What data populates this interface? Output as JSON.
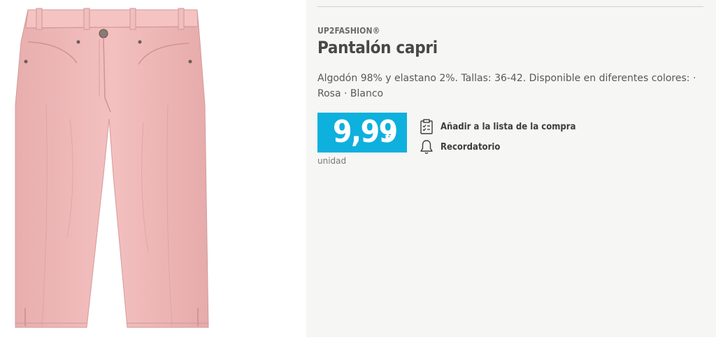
{
  "product": {
    "brand": "UP2FASHION®",
    "title": "Pantalón capri",
    "description": "Algodón 98% y elastano 2%. Tallas: 36-42. Disponible en diferentes colores: · Rosa · Blanco",
    "image_alt": "Pantalón capri rosa",
    "colors": {
      "pants": "#f0b9b8",
      "pants_shadow": "#dfa2a1",
      "price_bg": "#0eb0dd"
    }
  },
  "price": {
    "amount": "9,99",
    "currency": "€",
    "unit": "unidad"
  },
  "actions": {
    "add_to_list": {
      "label": "Añadir a la lista de la compra",
      "icon": "clipboard-checklist-icon"
    },
    "reminder": {
      "label": "Recordatorio",
      "icon": "bell-icon"
    }
  }
}
